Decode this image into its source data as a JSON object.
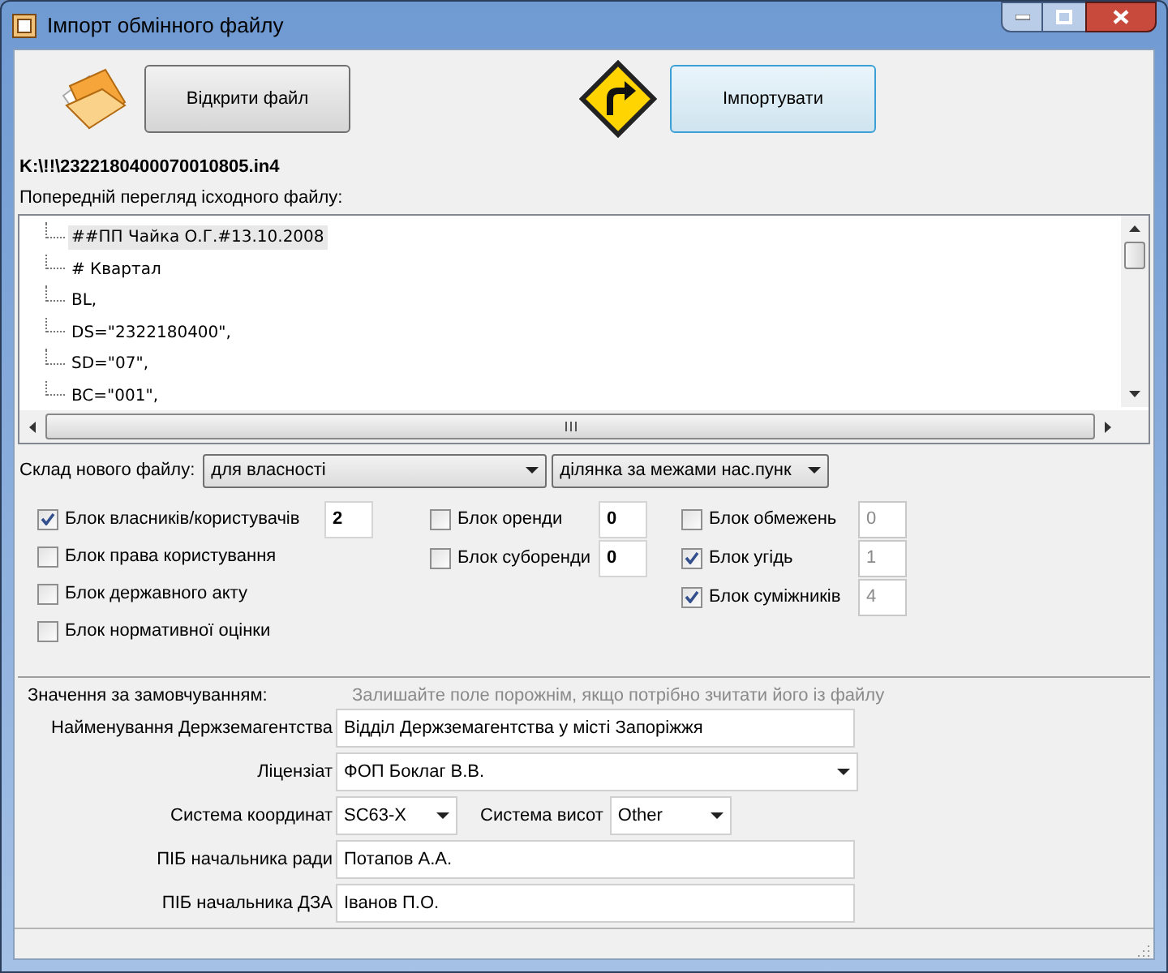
{
  "window": {
    "title": "Імпорт обмінного файлу"
  },
  "toolbar": {
    "open_button": "Відкрити файл",
    "import_button": "Імпортувати"
  },
  "file_path": "K:\\!!\\2322180400070010805.in4",
  "preview": {
    "label": "Попередній перегляд ісходного файлу:",
    "lines": [
      {
        "text": "##ПП Чайка О.Г.#13.10.2008",
        "selected": true
      },
      {
        "text": "# Квартал",
        "selected": false
      },
      {
        "text": "BL,",
        "selected": false
      },
      {
        "text": "DS=\"2322180400\",",
        "selected": false
      },
      {
        "text": "SD=\"07\",",
        "selected": false
      },
      {
        "text": "BC=\"001\",",
        "selected": false
      }
    ]
  },
  "composition": {
    "label": "Склад нового файлу:",
    "combo_1": "для власності",
    "combo_2": "ділянка за межами нас.пунк"
  },
  "block_groups": [
    {
      "blocks": [
        {
          "label": "Блок власників/користувачів",
          "checked": true,
          "count": "2",
          "count_disabled": false
        },
        {
          "label": "Блок права користування",
          "checked": false
        },
        {
          "label": "Блок державного акту",
          "checked": false
        },
        {
          "label": "Блок нормативної оцінки",
          "checked": false
        }
      ]
    },
    {
      "blocks": [
        {
          "label": "Блок оренди",
          "checked": false,
          "count": "0",
          "count_disabled": false
        },
        {
          "label": "Блок суборенди",
          "checked": false,
          "count": "0",
          "count_disabled": false
        }
      ]
    },
    {
      "blocks": [
        {
          "label": "Блок обмежень",
          "checked": false,
          "count": "0",
          "count_disabled": true
        },
        {
          "label": "Блок угідь",
          "checked": true,
          "count": "1",
          "count_disabled": true
        },
        {
          "label": "Блок суміжників",
          "checked": true,
          "count": "4",
          "count_disabled": true
        }
      ]
    }
  ],
  "defaults": {
    "label": "Значення за замовчуванням:",
    "hint": "Залишайте поле порожнім, якщо потрібно зчитати його із файлу",
    "fields": [
      {
        "kind": "text",
        "label": "Найменування Держземагентства",
        "value": "Відділ Держземагентства у місті Запоріжжя"
      },
      {
        "kind": "combo",
        "label": "Ліцензіат",
        "value": "ФОП Боклаг В.В."
      },
      {
        "kind": "pair",
        "label": "Система координат",
        "value": "SC63-X",
        "label_2": "Система висот",
        "value_2": "Other"
      },
      {
        "kind": "text",
        "label": "ПІБ начальника ради",
        "value": "Потапов А.А."
      },
      {
        "kind": "text",
        "label": "ПІБ начальника ДЗА",
        "value": "Іванов П.О."
      }
    ]
  }
}
